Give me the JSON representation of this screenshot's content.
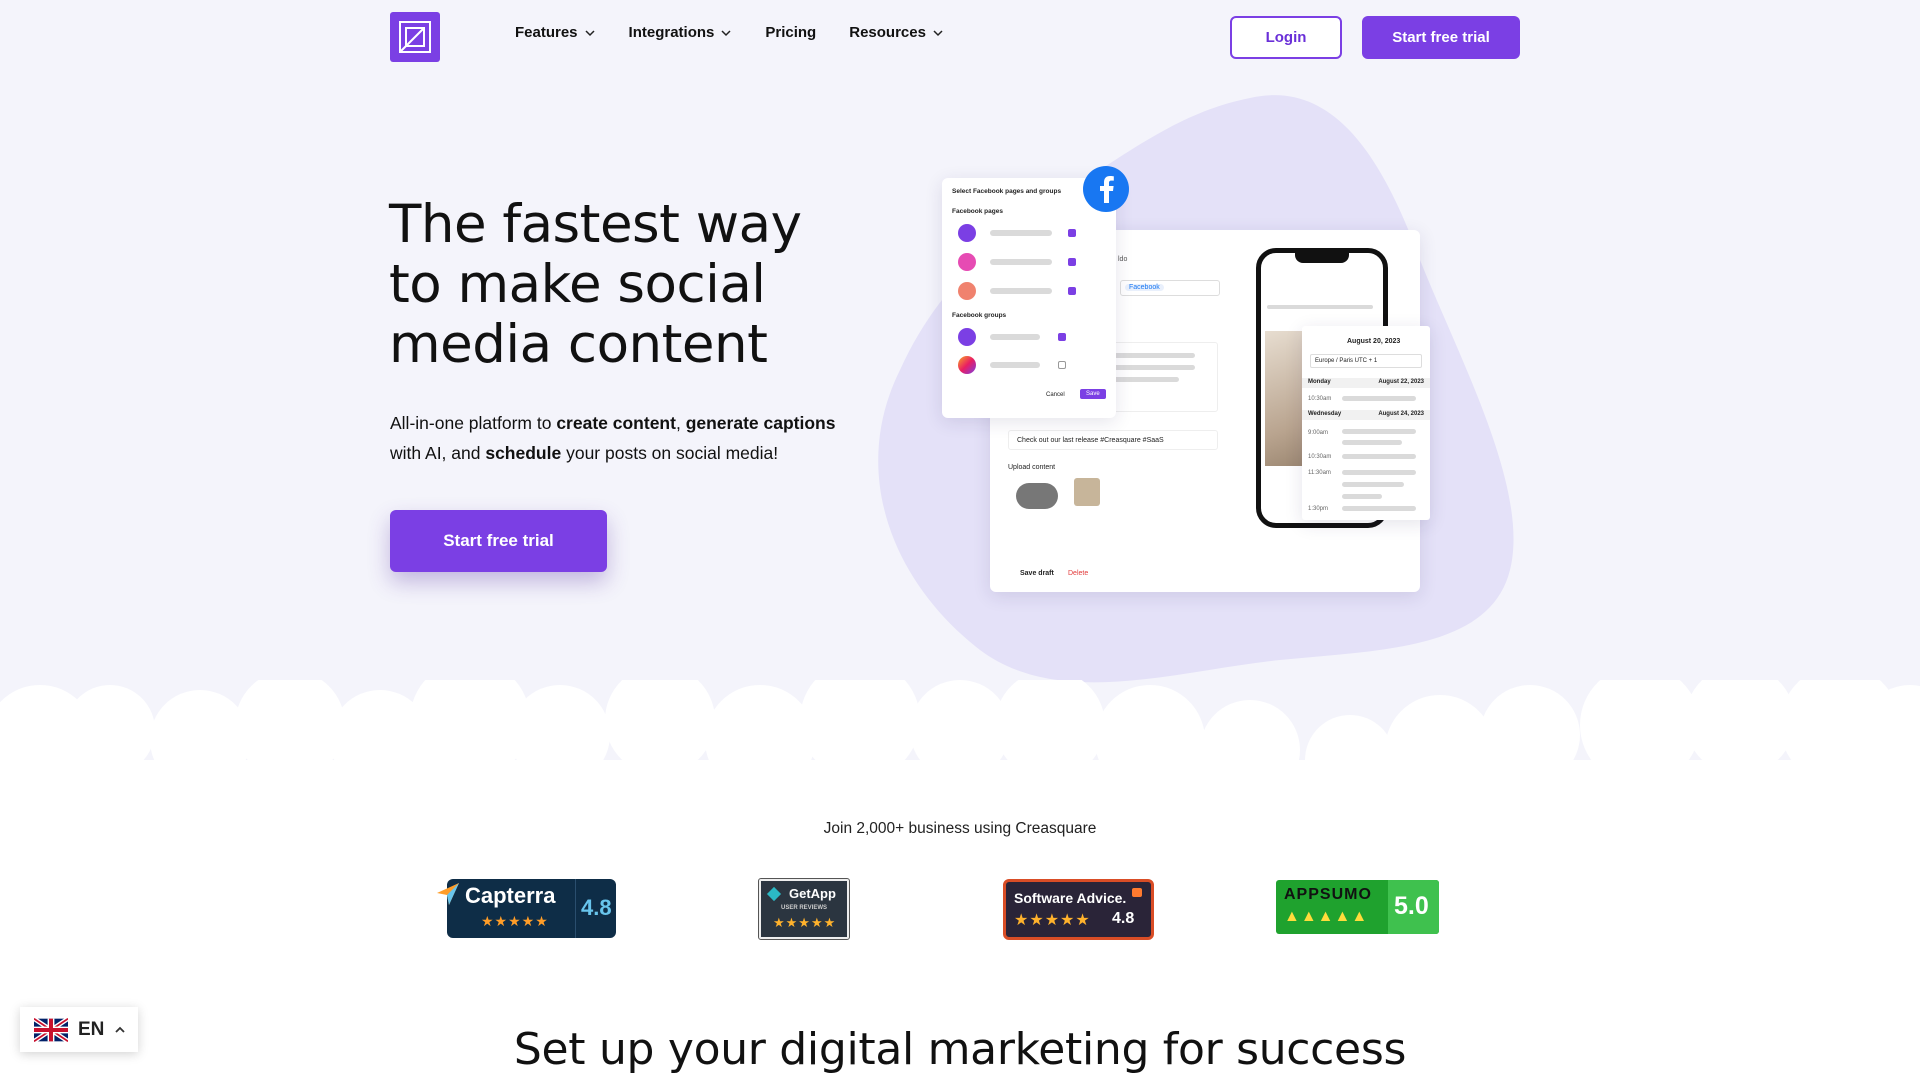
{
  "header": {
    "nav": [
      {
        "label": "Features",
        "has_dropdown": true
      },
      {
        "label": "Integrations",
        "has_dropdown": true
      },
      {
        "label": "Pricing",
        "has_dropdown": false
      },
      {
        "label": "Resources",
        "has_dropdown": true
      }
    ],
    "login_label": "Login",
    "trial_label": "Start free trial"
  },
  "hero": {
    "title": "The fastest way to make social media content",
    "sub_pre": "All-in-one platform to ",
    "sub_b1": "create content",
    "sub_mid1": ", ",
    "sub_b2": "generate captions",
    "sub_mid2": " with AI, and ",
    "sub_b3": "schedule",
    "sub_post": " your posts on social media!",
    "cta_label": "Start free trial"
  },
  "illustration": {
    "fb_card": {
      "title": "Select Facebook pages and groups",
      "pages_label": "Facebook pages",
      "groups_label": "Facebook groups",
      "cancel": "Cancel",
      "save": "Save"
    },
    "editor": {
      "post_text": "Check out our last release #Creasquare #SaaS",
      "upload_label": "Upload content",
      "save_draft": "Save draft",
      "delete": "Delete",
      "channel_chip": "Facebook"
    },
    "calendar": {
      "date": "August 20, 2023",
      "timezone": "Europe / Paris UTC + 1",
      "day1": "Monday",
      "day1_date": "August 22, 2023",
      "day2": "Wednesday",
      "day2_date": "August 24, 2023",
      "times": [
        "10:30am",
        "9:00am",
        "10:30am",
        "11:30am",
        "1:30pm"
      ]
    }
  },
  "social_proof": {
    "join_text": "Join 2,000+ business using Creasquare",
    "badges": [
      {
        "name": "Capterra",
        "score": "4.8"
      },
      {
        "name": "GetApp",
        "sub": "USER REVIEWS"
      },
      {
        "name": "Software Advice.",
        "score": "4.8"
      },
      {
        "name": "APPSUMO",
        "score": "5.0"
      }
    ]
  },
  "language": {
    "code": "EN"
  },
  "section": {
    "title": "Set up your digital marketing for success"
  },
  "colors": {
    "accent": "#7b3fe4",
    "blob": "#e4e1f8",
    "background": "#f4f4fb"
  }
}
